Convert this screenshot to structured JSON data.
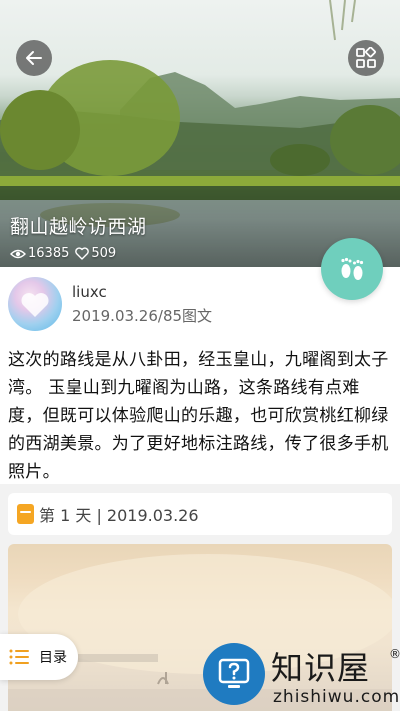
{
  "hero": {
    "title": "翻山越岭访西湖",
    "views": "16385",
    "likes": "509"
  },
  "author": {
    "name": "liuxc",
    "meta": "2019.03.26/85图文"
  },
  "description": "这次的路线是从八卦田，经玉皇山，九曜阁到太子湾。 玉皇山到九曜阁为山路，这条路线有点难度，但既可以体验爬山的乐趣，也可欣赏桃红柳绿的西湖美景。为了更好地标注路线，传了很多手机照片。",
  "day": {
    "label": "第 1 天 | 2019.03.26"
  },
  "toc": {
    "label": "目录"
  },
  "watermark": {
    "title": "知识屋",
    "reg": "®",
    "url": "zhishiwu.com"
  },
  "colors": {
    "fab": "#6fcfbd",
    "day_icon": "#f5a623",
    "watermark_blue": "#1f7bc1"
  },
  "icons": {
    "back": "arrow-left-icon",
    "grid": "grid-icon",
    "views": "eye-icon",
    "likes": "heart-icon",
    "feet": "footprints-icon",
    "toc": "list-icon",
    "watermark": "question-monitor-icon"
  }
}
